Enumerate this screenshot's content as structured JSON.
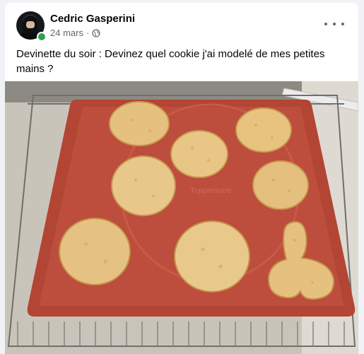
{
  "post": {
    "author": "Cedric Gasperini",
    "date": "24 mars",
    "separator": "·",
    "audience_icon": "globe-icon",
    "caption": "Devinette du soir : Devinez quel cookie j'ai modelé de mes petites mains ?",
    "more_icon": "more-options-icon"
  },
  "photo": {
    "watermark": "Tupperware"
  }
}
